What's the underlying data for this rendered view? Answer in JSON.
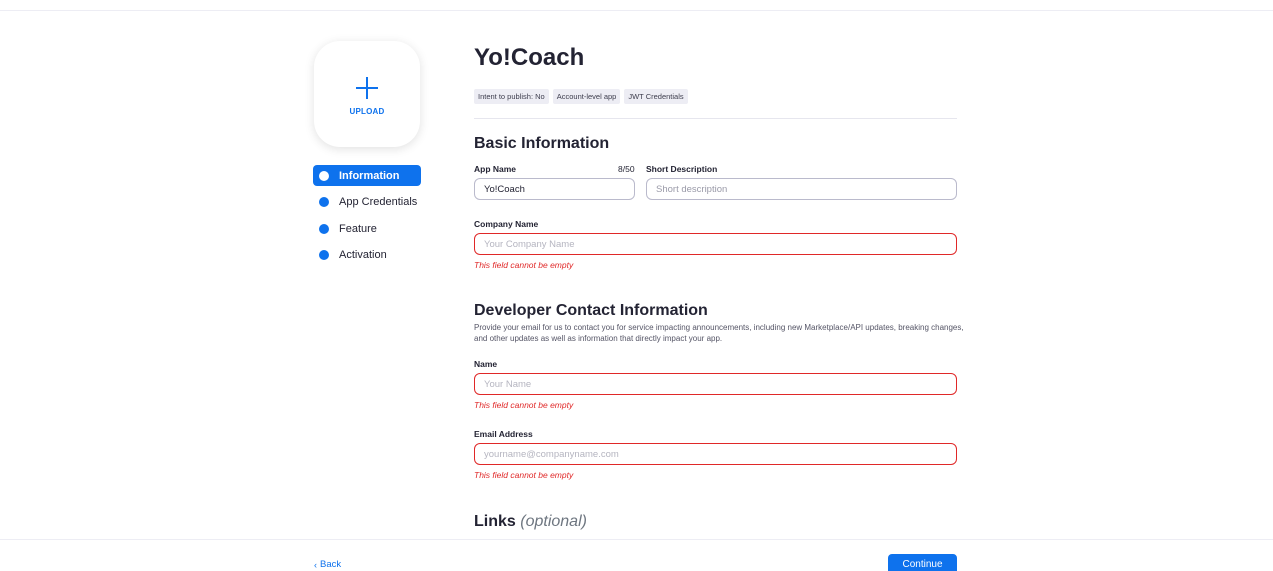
{
  "upload": {
    "label": "UPLOAD",
    "icon": "plus-icon"
  },
  "nav": {
    "items": [
      {
        "label": "Information",
        "active": true
      },
      {
        "label": "App Credentials",
        "active": false
      },
      {
        "label": "Feature",
        "active": false
      },
      {
        "label": "Activation",
        "active": false
      }
    ]
  },
  "app": {
    "title": "Yo!Coach",
    "tags": [
      "Intent to publish: No",
      "Account-level app",
      "JWT Credentials"
    ]
  },
  "basic_info": {
    "title": "Basic Information",
    "app_name_label": "App Name",
    "app_name_counter": "8/50",
    "app_name_value": "Yo!Coach",
    "short_desc_label": "Short Description",
    "short_desc_placeholder": "Short description",
    "company_label": "Company Name",
    "company_placeholder": "Your Company Name",
    "company_error": "This field cannot be empty"
  },
  "developer": {
    "title": "Developer Contact Information",
    "description": "Provide your email for us to contact you for service impacting announcements, including new Marketplace/API updates, breaking changes, and other updates as well as information that directly impact your app.",
    "name_label": "Name",
    "name_placeholder": "Your Name",
    "name_error": "This field cannot be empty",
    "email_label": "Email Address",
    "email_placeholder": "yourname@companyname.com",
    "email_error": "This field cannot be empty"
  },
  "links": {
    "title": "Links",
    "optional": "(optional)"
  },
  "footer": {
    "back_label": "Back",
    "continue_label": "Continue"
  },
  "colors": {
    "accent": "#0e72ed",
    "error": "#e02828",
    "tag_bg": "#ededf4"
  }
}
